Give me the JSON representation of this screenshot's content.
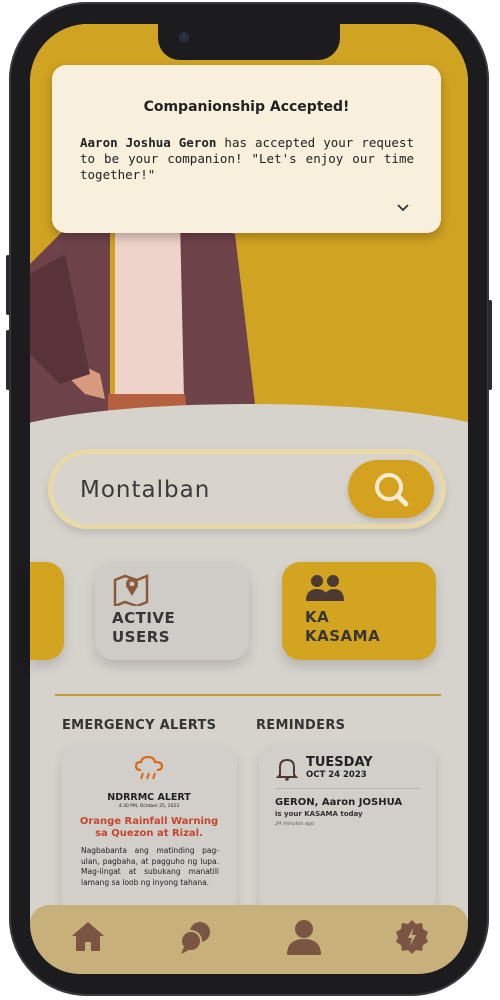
{
  "notification": {
    "title": "Companionship Accepted!",
    "name": "Aaron Joshua Geron",
    "message": " has accepted your request to be your companion! \"Let's enjoy our time together!\""
  },
  "search": {
    "value": "Montalban"
  },
  "cards": {
    "active_users_line1": "ACTIVE",
    "active_users_line2": "USERS",
    "ka_kasama_line1": "KA",
    "ka_kasama_line2": "KASAMA"
  },
  "sections": {
    "emergency_alerts": "EMERGENCY ALERTS",
    "reminders": "REMINDERS"
  },
  "alert": {
    "title": "NDRRMC ALERT",
    "timestamp": "4:30 PM, October 25, 2023",
    "headline_line1": "Orange Rainfall Warning",
    "headline_line2": "sa Quezon at Rizal.",
    "body": "Nagbabanta ang matinding pag-ulan, pagbaha, at pagguho ng lupa. Mag-iingat at subukang manatili lamang sa loob ng inyong tahana."
  },
  "reminder": {
    "day": "TUESDAY",
    "date": "OCT 24 2023",
    "name": "GERON, Aaron JOSHUA",
    "text": "is your KASAMA today",
    "time_ago": "24 minutes ago"
  },
  "colors": {
    "gold": "#d3a41f",
    "background": "#d6d3cd",
    "alert_red": "#c6452e",
    "nav_brown": "#7a5543"
  }
}
